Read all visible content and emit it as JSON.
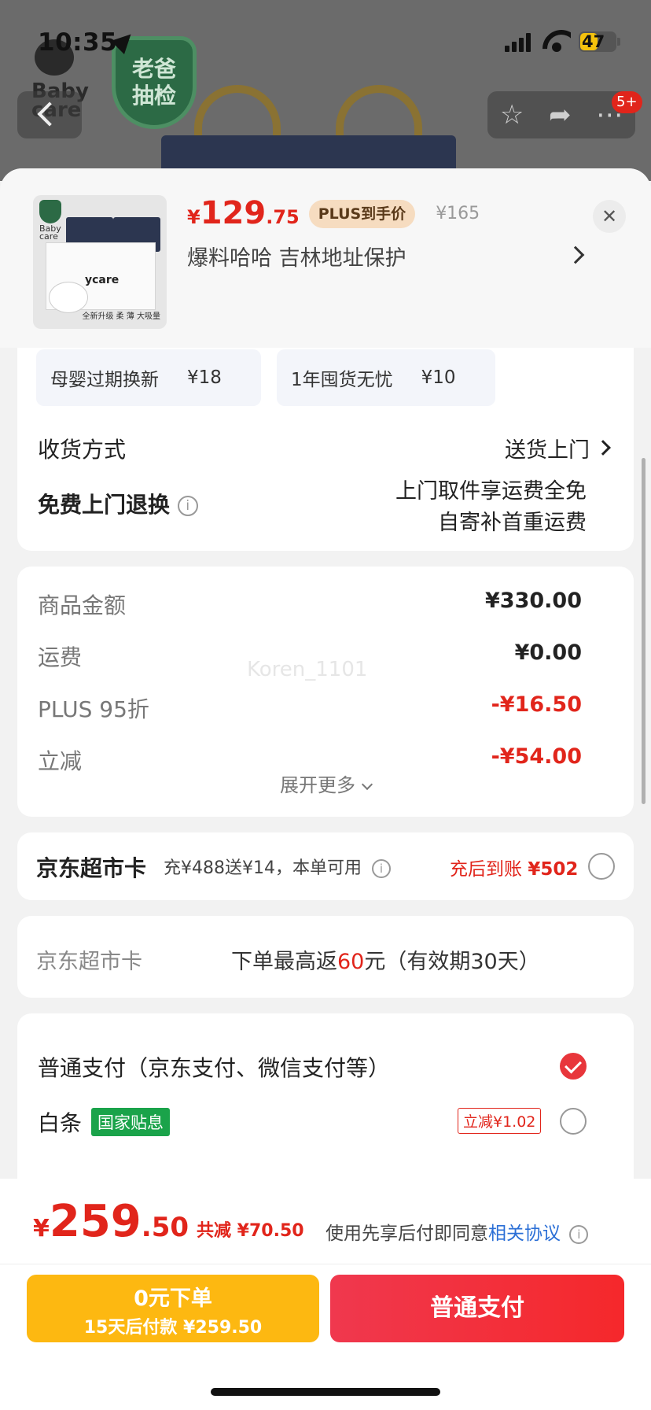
{
  "status_bar": {
    "time": "10:35",
    "battery": "47"
  },
  "background": {
    "shield_text": [
      "老爸",
      "抽检"
    ],
    "logo_text": [
      "Baby",
      "care"
    ],
    "badge_count": "5+"
  },
  "product": {
    "price_yen": "¥",
    "price_int": "129",
    "price_dec": ".75",
    "plus_label": "PLUS到手价",
    "original_price": "¥165",
    "promo_text": "爆料哈哈  吉林地址保护",
    "thumb_brand": "ycare",
    "thumb_tagline": "全新升级 柔 薄 大吸量"
  },
  "services": [
    {
      "name": "母婴过期换新",
      "amount": "¥18"
    },
    {
      "name": "1年囤货无忧",
      "amount": "¥10"
    }
  ],
  "delivery": {
    "label": "收货方式",
    "value": "送货上门"
  },
  "returns": {
    "label": "免费上门退换",
    "line1": "上门取件享运费全免",
    "line2": "自寄补首重运费"
  },
  "summary": {
    "rows": [
      {
        "label": "商品金额",
        "value": "¥330.00"
      },
      {
        "label": "运费",
        "value": "¥0.00"
      },
      {
        "label": "PLUS 95折",
        "value": "-¥16.50"
      },
      {
        "label": "立减",
        "value": "-¥54.00"
      }
    ],
    "expand_label": "展开更多",
    "watermark": "Koren_1101"
  },
  "supermarket_card": {
    "title": "京东超市卡",
    "desc": "充¥488送¥14，本单可用",
    "credit": "充后到账",
    "credit_amount": "¥502"
  },
  "cashback": {
    "label": "京东超市卡",
    "prefix": "下单最高返",
    "amount": "60",
    "suffix": "元（有效期30天）"
  },
  "payment": {
    "normal_label": "普通支付（京东支付、微信支付等）",
    "baitiao_label": "白条",
    "baitiao_badge": "国家贴息",
    "baitiao_discount": "立减¥1.02"
  },
  "footer": {
    "total_yen": "¥",
    "total_int": "259",
    "total_dec": ".50",
    "total_save": "共减 ¥70.50",
    "agree_prefix": "使用先享后付即同意",
    "agree_link": "相关协议",
    "btn_zero_line1": "0元下单",
    "btn_zero_line2": "15天后付款 ¥259.50",
    "btn_normal": "普通支付"
  },
  "colors": {
    "accent_red": "#e1251b",
    "pay_yellow": "#fdb811",
    "link_blue": "#2b6fd6",
    "gov_green": "#1aa34a"
  }
}
